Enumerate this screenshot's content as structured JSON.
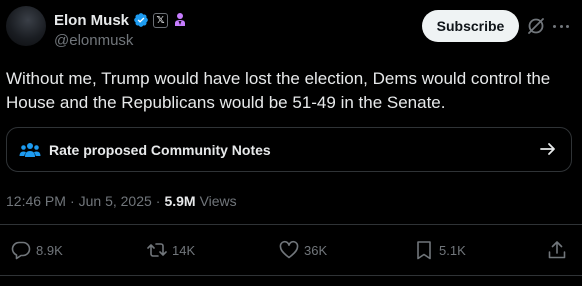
{
  "author": {
    "display_name": "Elon Musk",
    "handle": "@elonmusk",
    "x_badge_text": "𝕏"
  },
  "header": {
    "subscribe_label": "Subscribe"
  },
  "tweet": {
    "text": "Without me, Trump would have lost the election, Dems would control the House and the Republicans would be 51-49 in the Senate."
  },
  "community_notes": {
    "label": "Rate proposed Community Notes"
  },
  "meta": {
    "time": "12:46 PM",
    "separator1": "·",
    "date": "Jun 5, 2025",
    "separator2": "·",
    "views_count": "5.9M",
    "views_label": "Views"
  },
  "actions": {
    "replies": "8.9K",
    "reposts": "14K",
    "likes": "36K",
    "bookmarks": "5.1K"
  },
  "colors": {
    "background": "#000000",
    "text_primary": "#e7e9ea",
    "text_secondary": "#71767b",
    "verified_blue": "#1d9bf0",
    "affiliation_pink": "#c77dff",
    "notes_blue": "#1d9bf0",
    "border": "#2f3336"
  }
}
